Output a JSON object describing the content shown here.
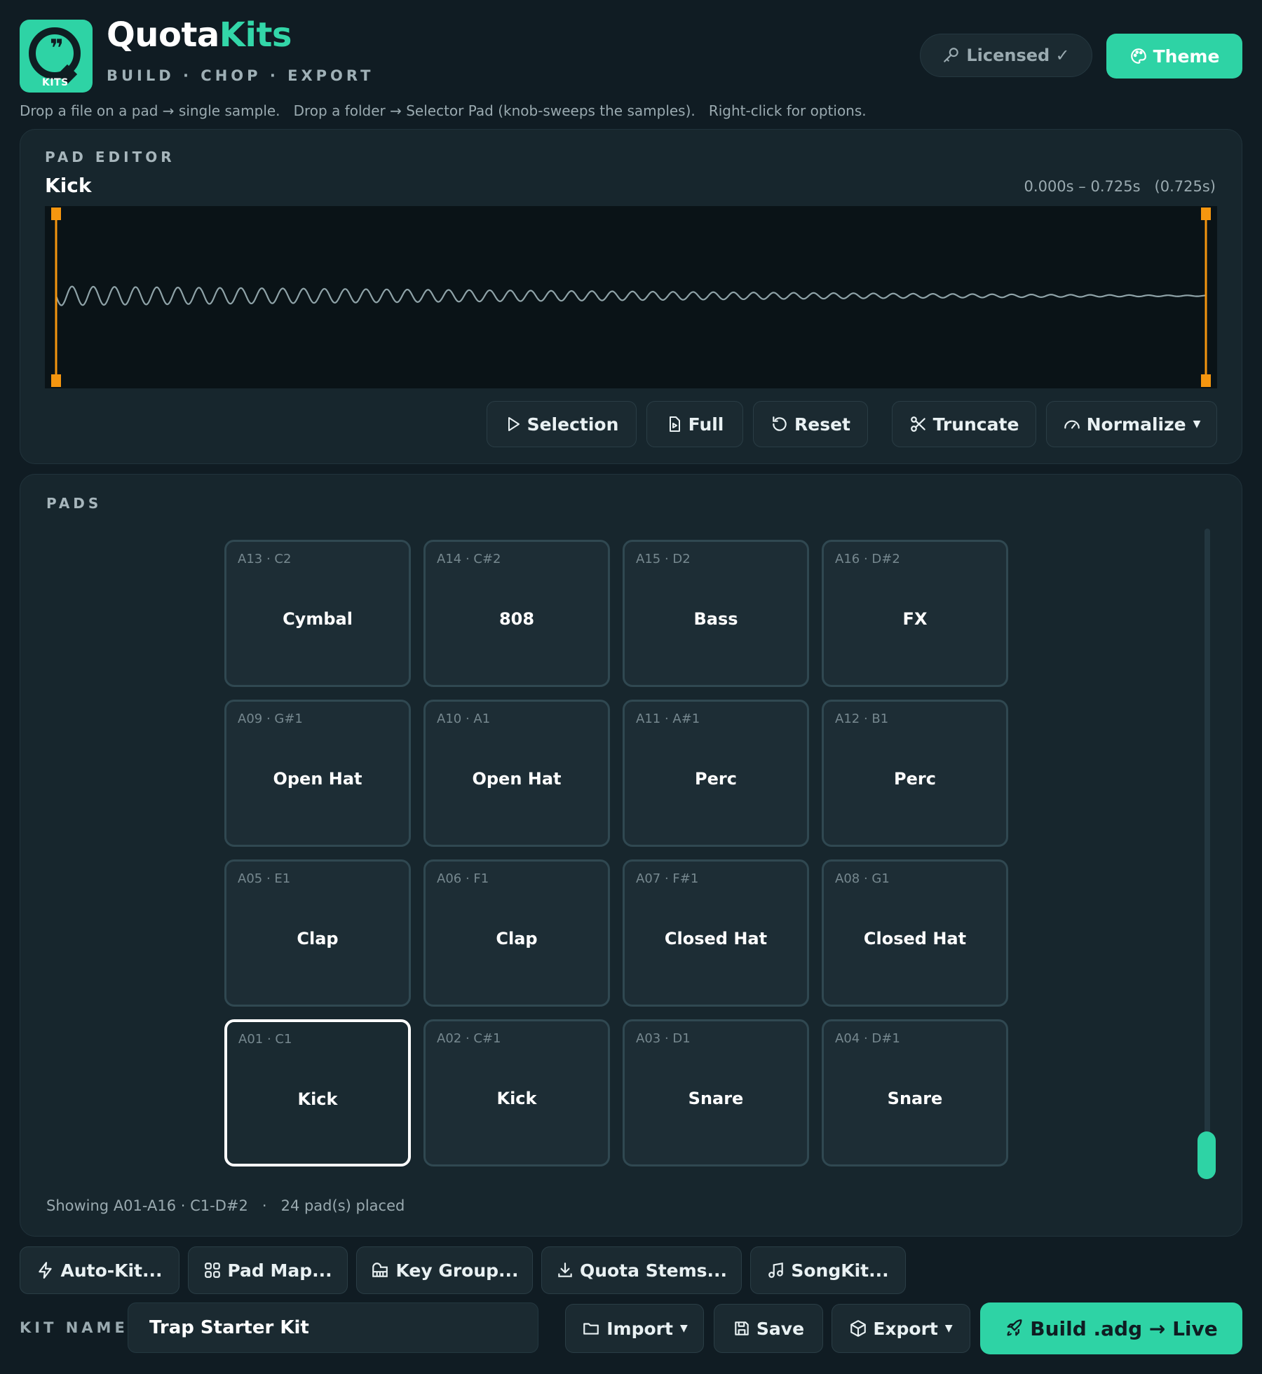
{
  "app": {
    "brand_part1": "Quota",
    "brand_part2": "Kits",
    "logo_badge": "KITS",
    "tagline": "BUILD · CHOP · EXPORT",
    "licensed_label": "Licensed ✓",
    "theme_label": "Theme",
    "hint": "Drop a file on a pad → single sample.   Drop a folder → Selector Pad (knob-sweeps the samples).   Right-click for options."
  },
  "editor": {
    "section": "PAD EDITOR",
    "pad_name": "Kick",
    "range": "0.000s – 0.725s   (0.725s)",
    "buttons": {
      "selection": "Selection",
      "full": "Full",
      "reset": "Reset",
      "truncate": "Truncate",
      "normalize": "Normalize"
    }
  },
  "pads": {
    "section": "PADS",
    "rows": [
      [
        {
          "note": "A13 · C2",
          "label": "Cymbal"
        },
        {
          "note": "A14 · C#2",
          "label": "808"
        },
        {
          "note": "A15 · D2",
          "label": "Bass"
        },
        {
          "note": "A16 · D#2",
          "label": "FX"
        }
      ],
      [
        {
          "note": "A09 · G#1",
          "label": "Open Hat"
        },
        {
          "note": "A10 · A1",
          "label": "Open Hat"
        },
        {
          "note": "A11 · A#1",
          "label": "Perc"
        },
        {
          "note": "A12 · B1",
          "label": "Perc"
        }
      ],
      [
        {
          "note": "A05 · E1",
          "label": "Clap"
        },
        {
          "note": "A06 · F1",
          "label": "Clap"
        },
        {
          "note": "A07 · F#1",
          "label": "Closed Hat"
        },
        {
          "note": "A08 · G1",
          "label": "Closed Hat"
        }
      ],
      [
        {
          "note": "A01 · C1",
          "label": "Kick"
        },
        {
          "note": "A02 · C#1",
          "label": "Kick"
        },
        {
          "note": "A03 · D1",
          "label": "Snare"
        },
        {
          "note": "A04 · D#1",
          "label": "Snare"
        }
      ]
    ],
    "status": "Showing A01-A16 · C1-D#2   ·   24 pad(s) placed"
  },
  "tools": {
    "auto_kit": "Auto-Kit...",
    "pad_map": "Pad Map...",
    "key_group": "Key Group...",
    "quota_stems": "Quota Stems...",
    "songkit": "SongKit..."
  },
  "footer": {
    "kit_label": "KIT NAME",
    "kit_name": "Trap Starter Kit",
    "import": "Import",
    "save": "Save",
    "export": "Export",
    "build": "Build .adg → Live"
  },
  "colors": {
    "accent": "#2ed3a5",
    "marker": "#f5960f",
    "background": "#101c23",
    "panel": "#17262d"
  }
}
